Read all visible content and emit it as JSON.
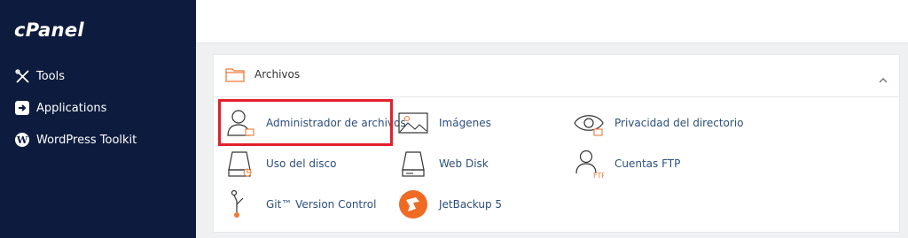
{
  "sidebar": {
    "logo": "cPanel",
    "items": [
      {
        "label": "Tools",
        "icon": "tools-icon"
      },
      {
        "label": "Applications",
        "icon": "applications-icon"
      },
      {
        "label": "WordPress Toolkit",
        "icon": "wordpress-icon"
      }
    ]
  },
  "section": {
    "title": "Archivos",
    "icon": "folder-icon",
    "collapse_icon": "chevron-up-icon",
    "items": [
      {
        "label": "Administrador de archivos",
        "icon": "file-manager-icon"
      },
      {
        "label": "Imágenes",
        "icon": "images-icon"
      },
      {
        "label": "Privacidad del directorio",
        "icon": "directory-privacy-icon"
      },
      {
        "label": "Uso del disco",
        "icon": "disk-usage-icon"
      },
      {
        "label": "Web Disk",
        "icon": "web-disk-icon"
      },
      {
        "label": "Cuentas FTP",
        "icon": "ftp-accounts-icon"
      },
      {
        "label": "Git™ Version Control",
        "icon": "git-icon"
      },
      {
        "label": "JetBackup 5",
        "icon": "jetbackup-icon"
      }
    ],
    "ftp_badge": "FTP"
  },
  "colors": {
    "sidebar_bg": "#0d1b3e",
    "link": "#2c4f7c",
    "accent_orange": "#ef7b3a",
    "highlight_red": "#e2202c"
  }
}
